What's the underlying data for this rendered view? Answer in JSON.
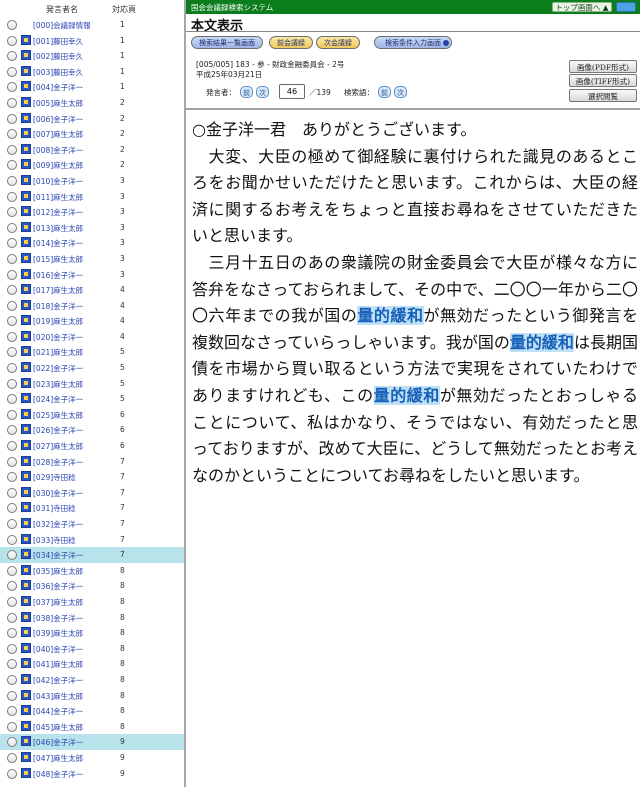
{
  "sidebar": {
    "header_speaker": "発言者名",
    "header_count": "対応頁",
    "rows": [
      {
        "name": "[000]会議録情報",
        "count": "1",
        "selected": false,
        "icon": false
      },
      {
        "name": "[001]藤田幸久",
        "count": "1",
        "selected": false,
        "icon": true
      },
      {
        "name": "[002]藤田幸久",
        "count": "1",
        "selected": false,
        "icon": true
      },
      {
        "name": "[003]藤田幸久",
        "count": "1",
        "selected": false,
        "icon": true
      },
      {
        "name": "[004]金子洋一",
        "count": "1",
        "selected": false,
        "icon": true
      },
      {
        "name": "[005]麻生太郎",
        "count": "2",
        "selected": false,
        "icon": true
      },
      {
        "name": "[006]金子洋一",
        "count": "2",
        "selected": false,
        "icon": true
      },
      {
        "name": "[007]麻生太郎",
        "count": "2",
        "selected": false,
        "icon": true
      },
      {
        "name": "[008]金子洋一",
        "count": "2",
        "selected": false,
        "icon": true
      },
      {
        "name": "[009]麻生太郎",
        "count": "2",
        "selected": false,
        "icon": true
      },
      {
        "name": "[010]金子洋一",
        "count": "3",
        "selected": false,
        "icon": true
      },
      {
        "name": "[011]麻生太郎",
        "count": "3",
        "selected": false,
        "icon": true
      },
      {
        "name": "[012]金子洋一",
        "count": "3",
        "selected": false,
        "icon": true
      },
      {
        "name": "[013]麻生太郎",
        "count": "3",
        "selected": false,
        "icon": true
      },
      {
        "name": "[014]金子洋一",
        "count": "3",
        "selected": false,
        "icon": true
      },
      {
        "name": "[015]麻生太郎",
        "count": "3",
        "selected": false,
        "icon": true
      },
      {
        "name": "[016]金子洋一",
        "count": "3",
        "selected": false,
        "icon": true
      },
      {
        "name": "[017]麻生太郎",
        "count": "4",
        "selected": false,
        "icon": true
      },
      {
        "name": "[018]金子洋一",
        "count": "4",
        "selected": false,
        "icon": true
      },
      {
        "name": "[019]麻生太郎",
        "count": "4",
        "selected": false,
        "icon": true
      },
      {
        "name": "[020]金子洋一",
        "count": "4",
        "selected": false,
        "icon": true
      },
      {
        "name": "[021]麻生太郎",
        "count": "5",
        "selected": false,
        "icon": true
      },
      {
        "name": "[022]金子洋一",
        "count": "5",
        "selected": false,
        "icon": true
      },
      {
        "name": "[023]麻生太郎",
        "count": "5",
        "selected": false,
        "icon": true
      },
      {
        "name": "[024]金子洋一",
        "count": "5",
        "selected": false,
        "icon": true
      },
      {
        "name": "[025]麻生太郎",
        "count": "6",
        "selected": false,
        "icon": true
      },
      {
        "name": "[026]金子洋一",
        "count": "6",
        "selected": false,
        "icon": true
      },
      {
        "name": "[027]麻生太郎",
        "count": "6",
        "selected": false,
        "icon": true
      },
      {
        "name": "[028]金子洋一",
        "count": "7",
        "selected": false,
        "icon": true
      },
      {
        "name": "[029]寺田稔",
        "count": "7",
        "selected": false,
        "icon": true
      },
      {
        "name": "[030]金子洋一",
        "count": "7",
        "selected": false,
        "icon": true
      },
      {
        "name": "[031]寺田稔",
        "count": "7",
        "selected": false,
        "icon": true
      },
      {
        "name": "[032]金子洋一",
        "count": "7",
        "selected": false,
        "icon": true
      },
      {
        "name": "[033]寺田稔",
        "count": "7",
        "selected": false,
        "icon": true
      },
      {
        "name": "[034]金子洋一",
        "count": "7",
        "selected": true,
        "icon": true
      },
      {
        "name": "[035]麻生太郎",
        "count": "8",
        "selected": false,
        "icon": true
      },
      {
        "name": "[036]金子洋一",
        "count": "8",
        "selected": false,
        "icon": true
      },
      {
        "name": "[037]麻生太郎",
        "count": "8",
        "selected": false,
        "icon": true
      },
      {
        "name": "[038]金子洋一",
        "count": "8",
        "selected": false,
        "icon": true
      },
      {
        "name": "[039]麻生太郎",
        "count": "8",
        "selected": false,
        "icon": true
      },
      {
        "name": "[040]金子洋一",
        "count": "8",
        "selected": false,
        "icon": true
      },
      {
        "name": "[041]麻生太郎",
        "count": "8",
        "selected": false,
        "icon": true
      },
      {
        "name": "[042]金子洋一",
        "count": "8",
        "selected": false,
        "icon": true
      },
      {
        "name": "[043]麻生太郎",
        "count": "8",
        "selected": false,
        "icon": true
      },
      {
        "name": "[044]金子洋一",
        "count": "8",
        "selected": false,
        "icon": true
      },
      {
        "name": "[045]麻生太郎",
        "count": "8",
        "selected": false,
        "icon": true
      },
      {
        "name": "[046]金子洋一",
        "count": "9",
        "selected": true,
        "icon": true
      },
      {
        "name": "[047]麻生太郎",
        "count": "9",
        "selected": false,
        "icon": true
      },
      {
        "name": "[048]金子洋一",
        "count": "9",
        "selected": false,
        "icon": true
      }
    ]
  },
  "header": {
    "system_name": "国会会議録検索システム",
    "top_button": "トップ画面へ ▲",
    "help_button": "",
    "title": "本文表示"
  },
  "toolbar": {
    "results_button": "検索結果一覧画面",
    "prev_meeting_button": "前会議録",
    "next_meeting_button": "次会議録",
    "search_conditions_button": "検索条件入力画面"
  },
  "meeting": {
    "info": "[005/005] 183 - 参 - 財政金融委員会 - 2号",
    "date": "平成25年03月21日"
  },
  "speaker_nav": {
    "label": "発言者：",
    "prev": "前",
    "next": "次",
    "current": "46",
    "total": "／139",
    "keyword_label": "検索語：",
    "keyword_prev": "前",
    "keyword_next": "次"
  },
  "side_buttons": {
    "pdf": "画像(PDF形式)",
    "tiff": "画像(TIFF形式)",
    "select": "選択閲覧"
  },
  "speech": {
    "speaker": "○金子洋一君　ありがとうございます。",
    "p1": "　大変、大臣の極めて御経験に裏付けられた識見のあるところをお聞かせいただけたと思います。これからは、大臣の経済に関するお考えをちょっと直接お尋ねをさせていただきたいと思います。",
    "p2_a": "　三月十五日のあの衆議院の財金委員会で大臣が様々な方に答弁をなさっておられまして、その中で、二〇〇一年から二〇〇六年までの我が国の",
    "highlight_term": "量的緩和",
    "p2_b": "が無効だったという御発言を複数回なさっていらっしゃいます。我が国の",
    "p2_c": "は長期国債を市場から買い取るという方法で実現をされていたわけでありますけれども、この",
    "p2_d": "が無効だったとおっしゃることについて、私はかなり、そうではない、有効だったと思っておりますが、改めて大臣に、どうして無効だったとお考えなのかということについてお尋ねをしたいと思います。"
  },
  "colors": {
    "topbar": "#0c7d1d",
    "selected_row": "#b9e3ea",
    "highlight_bg": "#bfe0f6",
    "highlight_text": "#1660b8",
    "link": "#2945b4"
  }
}
